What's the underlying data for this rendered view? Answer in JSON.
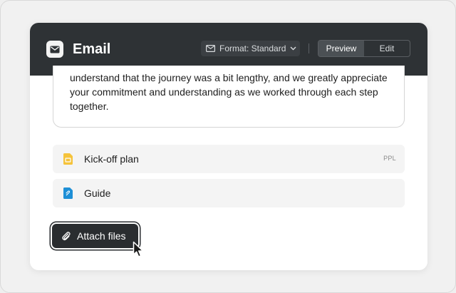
{
  "header": {
    "title": "Email",
    "app_icon": "envelope-icon",
    "format_label": "Format: Standard",
    "format_icon": "envelope-outline-icon",
    "tabs": [
      {
        "label": "Preview",
        "active": true
      },
      {
        "label": "Edit",
        "active": false
      }
    ]
  },
  "message": {
    "body": "understand that the journey was a bit lengthy, and we greatly appreciate your commitment and understanding as we worked through each step together."
  },
  "attachments": [
    {
      "name": "Kick-off plan",
      "tag": "PPL",
      "icon": "slides-file-icon",
      "color": "#f5c33b"
    },
    {
      "name": "Guide",
      "tag": "",
      "icon": "document-file-icon",
      "color": "#1e8fd6"
    }
  ],
  "actions": {
    "attach_label": "Attach files",
    "attach_icon": "paperclip-icon"
  },
  "colors": {
    "header_bg": "#2e3235",
    "button_bg": "#2a2d30"
  }
}
